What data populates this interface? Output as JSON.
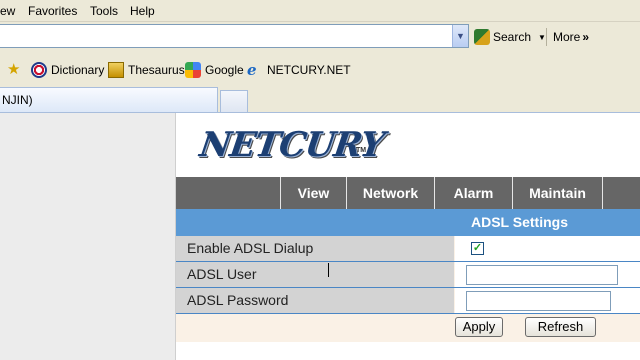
{
  "menu": {
    "items": [
      "ew",
      "Favorites",
      "Tools",
      "Help"
    ]
  },
  "toolbar": {
    "search_label": "Search",
    "more_label": "More"
  },
  "links": [
    "Dictionary",
    "Thesaurus",
    "Google",
    "NETCURY.NET"
  ],
  "tab": {
    "title": "NJIN)"
  },
  "page": {
    "logo": "NETCURY",
    "nav": [
      "View",
      "Network",
      "Alarm",
      "Maintain"
    ],
    "section_title": "ADSL Settings",
    "fields": {
      "enable_label": "Enable ADSL Dialup",
      "enable_checked": true,
      "user_label": "ADSL User",
      "user_value": "",
      "password_label": "ADSL Password",
      "password_value": ""
    },
    "buttons": {
      "apply": "Apply",
      "refresh": "Refresh"
    }
  },
  "colors": {
    "nav_bg": "#666666",
    "section_head": "#5b9ad5",
    "label_bg": "#d3d3d3",
    "form_bg": "#faf1e6"
  }
}
